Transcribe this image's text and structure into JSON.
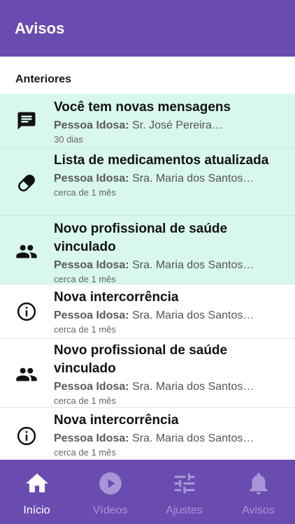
{
  "header": {
    "title": "Avisos"
  },
  "section": {
    "title": "Anteriores"
  },
  "notifications": [
    {
      "title": "Você tem novas mensagens",
      "label": "Pessoa Idosa:",
      "person": "Sr. José Pereira…",
      "time": "30 dias",
      "icon": "message-icon",
      "unread": true
    },
    {
      "title": "Lista de medicamentos atualizada",
      "label": "Pessoa Idosa:",
      "person": "Sra. Maria dos Santos…",
      "time": "cerca de 1 mês",
      "icon": "pill-icon",
      "unread": true
    },
    {
      "title": "Novo profissional de saúde vinculado",
      "label": "Pessoa Idosa:",
      "person": "Sra. Maria dos Santos…",
      "time": "cerca de 1 mês",
      "icon": "people-icon",
      "unread": true
    },
    {
      "title": "Nova intercorrência",
      "label": "Pessoa Idosa:",
      "person": "Sra. Maria dos Santos…",
      "time": "cerca de 1 mês",
      "icon": "info-icon",
      "unread": false
    },
    {
      "title": "Novo profissional de saúde vinculado",
      "label": "Pessoa Idosa:",
      "person": "Sra. Maria dos Santos…",
      "time": "cerca de 1 mês",
      "icon": "people-icon",
      "unread": false
    },
    {
      "title": "Nova intercorrência",
      "label": "Pessoa Idosa:",
      "person": "Sra. Maria dos Santos…",
      "time": "cerca de 1 mês",
      "icon": "info-icon",
      "unread": false
    }
  ],
  "nav": {
    "items": [
      {
        "label": "Início",
        "icon": "home-icon",
        "active": true
      },
      {
        "label": "Vídeos",
        "icon": "play-icon",
        "active": false
      },
      {
        "label": "Ajustes",
        "icon": "sliders-icon",
        "active": false
      },
      {
        "label": "Avisos",
        "icon": "bell-icon",
        "active": false
      }
    ]
  },
  "colors": {
    "primary": "#6a4bb0",
    "unread_bg": "#d8f7ee",
    "inactive_nav": "#a995d8"
  }
}
